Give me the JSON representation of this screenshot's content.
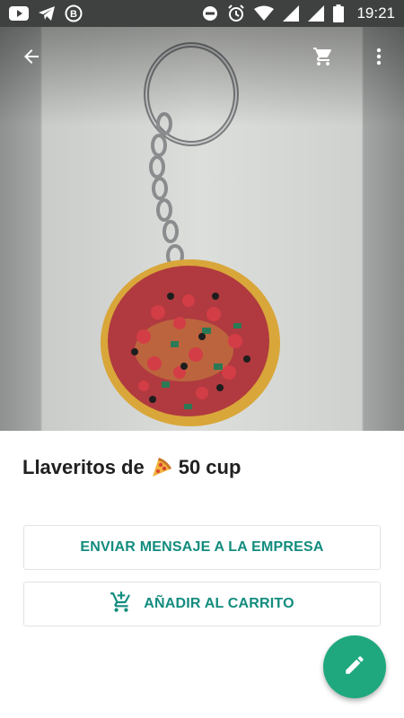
{
  "status_bar": {
    "time": "19:21",
    "left_icons": [
      "youtube-icon",
      "telegram-icon",
      "whatsapp-business-icon"
    ],
    "right_icons": [
      "do-not-disturb-icon",
      "alarm-icon",
      "wifi-icon",
      "signal-icon",
      "signal-icon",
      "battery-icon"
    ]
  },
  "app_bar": {
    "icons": [
      "back-arrow-icon",
      "shopping-cart-icon",
      "more-vertical-icon"
    ]
  },
  "product": {
    "title_text": "Llaveritos de",
    "title_emoji_icon": "pizza-emoji",
    "price_text": "50 cup",
    "image": "pizza-keychain-photo"
  },
  "actions": {
    "message_label": "ENVIAR MENSAJE A LA EMPRESA",
    "add_to_cart_label": "AÑADIR AL CARRITO",
    "add_to_cart_icon": "add-shopping-cart-icon"
  },
  "fab": {
    "icon": "pencil-edit-icon"
  },
  "colors": {
    "accent": "#128c7e",
    "fab": "#1fa87e",
    "status_bar": "#3f4140"
  }
}
